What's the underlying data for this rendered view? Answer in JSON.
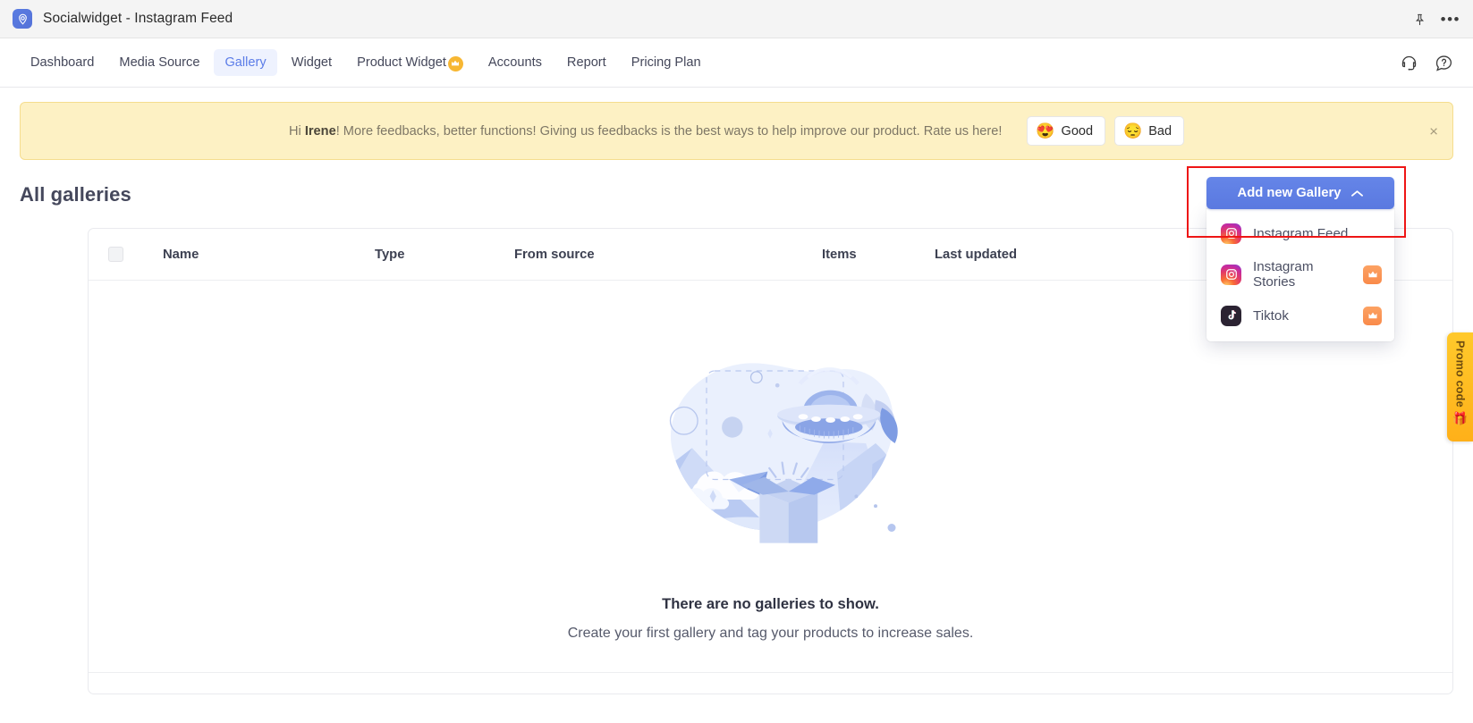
{
  "titlebar": {
    "app_title": "Socialwidget - Instagram Feed",
    "logo_icon": "socialwidget-logo-icon",
    "pin_icon": "pin-icon",
    "more_icon": "more-horizontal-icon"
  },
  "nav": {
    "items": [
      {
        "label": "Dashboard",
        "active": false,
        "badge": false
      },
      {
        "label": "Media Source",
        "active": false,
        "badge": false
      },
      {
        "label": "Gallery",
        "active": true,
        "badge": false
      },
      {
        "label": "Widget",
        "active": false,
        "badge": false
      },
      {
        "label": "Product Widget",
        "active": false,
        "badge": true
      },
      {
        "label": "Accounts",
        "active": false,
        "badge": false
      },
      {
        "label": "Report",
        "active": false,
        "badge": false
      },
      {
        "label": "Pricing Plan",
        "active": false,
        "badge": false
      }
    ],
    "support_icon": "headset-support-icon",
    "help_icon": "question-mark-help-icon"
  },
  "banner": {
    "greeting_prefix": "Hi ",
    "user_name": "Irene",
    "message": "! More feedbacks, better functions! Giving us feedbacks is the best ways to help improve our product. Rate us here!",
    "good_label": "Good",
    "good_emoji": "😍",
    "bad_label": "Bad",
    "bad_emoji": "😔",
    "close_label": "×",
    "bg_color": "#fdf1c4",
    "border_color": "#f5dd8e"
  },
  "page": {
    "title": "All galleries"
  },
  "add_gallery": {
    "button_label": "Add new Gallery",
    "button_color": "#5a79e0",
    "chevron_icon": "chevron-up-icon",
    "highlight_color": "#ee1616",
    "options": [
      {
        "label": "Instagram Feed",
        "icon": "instagram-icon",
        "pro": false
      },
      {
        "label": "Instagram Stories",
        "icon": "instagram-icon",
        "pro": true
      },
      {
        "label": "Tiktok",
        "icon": "tiktok-icon",
        "pro": true
      }
    ]
  },
  "table": {
    "select_all_checkbox": "select-all",
    "headers": [
      "Name",
      "Type",
      "From source",
      "Items",
      "Last updated"
    ],
    "rows": []
  },
  "empty_state": {
    "illustration": "ufo-abducting-box-illustration",
    "title": "There are no galleries to show.",
    "subtitle": "Create your first gallery and tag your products to increase sales."
  },
  "promo": {
    "label": "Promo code",
    "gift_emoji": "🎁",
    "color": "#ffb019"
  }
}
